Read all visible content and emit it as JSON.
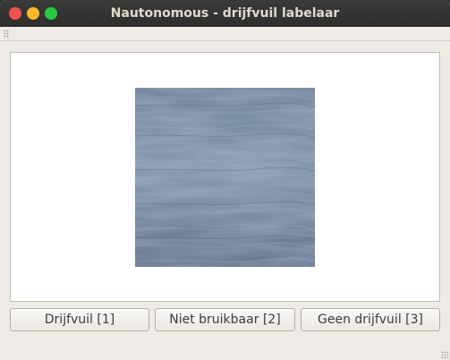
{
  "window": {
    "title": "Nautonomous - drijfvuil labelaar"
  },
  "image": {
    "description_icon": "water-surface-image",
    "colors": {
      "light": "#8fa2b8",
      "mid": "#6b7e96",
      "dark": "#4e5f78"
    }
  },
  "buttons": [
    {
      "label": "Drijfvuil [1]"
    },
    {
      "label": "Niet bruikbaar [2]"
    },
    {
      "label": "Geen drijfvuil [3]"
    }
  ],
  "colors": {
    "close": "#f0524f",
    "minimize": "#f7b929",
    "maximize": "#27c93f",
    "titlebar": "#2e2e2c",
    "window_bg": "#efebe7"
  }
}
